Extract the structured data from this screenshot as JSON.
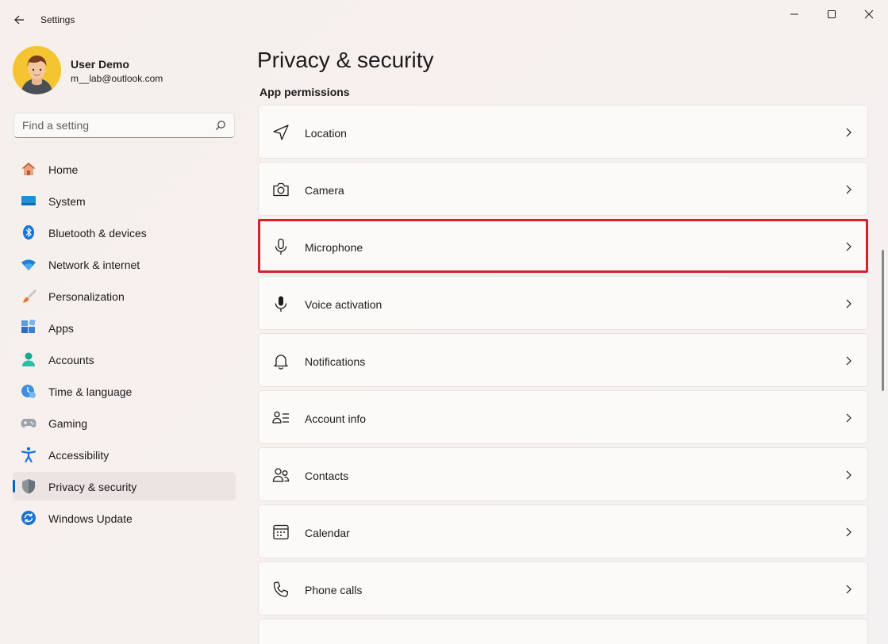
{
  "window": {
    "title": "Settings"
  },
  "profile": {
    "name": "User Demo",
    "email": "m__lab@outlook.com"
  },
  "search": {
    "placeholder": "Find a setting",
    "value": ""
  },
  "nav": {
    "items": [
      {
        "label": "Home",
        "icon": "home-icon"
      },
      {
        "label": "System",
        "icon": "system-icon"
      },
      {
        "label": "Bluetooth & devices",
        "icon": "bluetooth-icon"
      },
      {
        "label": "Network & internet",
        "icon": "wifi-icon"
      },
      {
        "label": "Personalization",
        "icon": "brush-icon"
      },
      {
        "label": "Apps",
        "icon": "apps-icon"
      },
      {
        "label": "Accounts",
        "icon": "accounts-icon"
      },
      {
        "label": "Time & language",
        "icon": "clock-globe-icon"
      },
      {
        "label": "Gaming",
        "icon": "gamepad-icon"
      },
      {
        "label": "Accessibility",
        "icon": "accessibility-icon"
      },
      {
        "label": "Privacy & security",
        "icon": "shield-icon",
        "active": true
      },
      {
        "label": "Windows Update",
        "icon": "update-icon"
      }
    ]
  },
  "main": {
    "page_title": "Privacy & security",
    "section_title": "App permissions",
    "permissions": [
      {
        "label": "Location",
        "icon": "location-icon"
      },
      {
        "label": "Camera",
        "icon": "camera-icon"
      },
      {
        "label": "Microphone",
        "icon": "microphone-icon",
        "highlighted": true
      },
      {
        "label": "Voice activation",
        "icon": "voice-icon"
      },
      {
        "label": "Notifications",
        "icon": "bell-icon"
      },
      {
        "label": "Account info",
        "icon": "account-info-icon"
      },
      {
        "label": "Contacts",
        "icon": "contacts-icon"
      },
      {
        "label": "Calendar",
        "icon": "calendar-icon"
      },
      {
        "label": "Phone calls",
        "icon": "phone-icon"
      }
    ]
  },
  "colors": {
    "accent": "#0067c0",
    "highlight_border": "#d8202b"
  }
}
